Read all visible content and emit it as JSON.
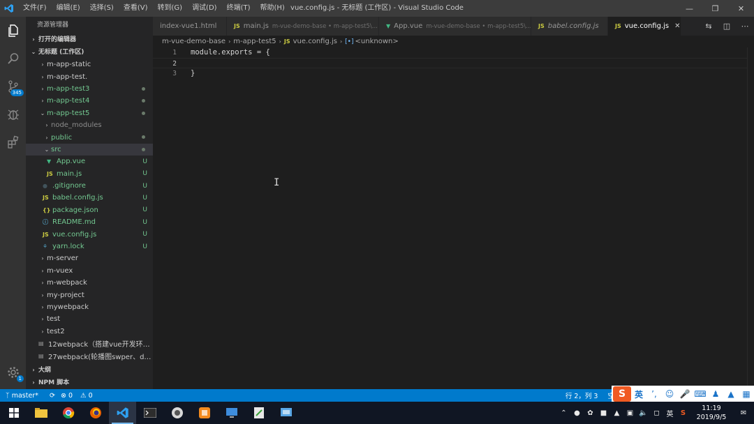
{
  "titlebar": {
    "menu": [
      "文件(F)",
      "编辑(E)",
      "选择(S)",
      "查看(V)",
      "转到(G)",
      "调试(D)",
      "终端(T)",
      "帮助(H)"
    ],
    "title": "vue.config.js - 无标题 (工作区) - Visual Studio Code"
  },
  "activity": {
    "scm_badge": "345",
    "settings_badge": "1"
  },
  "sidebar": {
    "title": "资源管理器",
    "open_editors": "打开的编辑器",
    "workspace": "无标题 (工作区)",
    "outline": "大纲",
    "npm": "NPM 脚本",
    "tree": [
      {
        "label": "m-app-static",
        "chev": "›",
        "indent": 1,
        "color": "white"
      },
      {
        "label": "m-app-test.",
        "chev": "›",
        "indent": 1,
        "color": "white"
      },
      {
        "label": "m-app-test3",
        "chev": "›",
        "indent": 1,
        "color": "green",
        "dot": true
      },
      {
        "label": "m-app-test4",
        "chev": "›",
        "indent": 1,
        "color": "green",
        "dot": true
      },
      {
        "label": "m-app-test5",
        "chev": "⌄",
        "indent": 1,
        "color": "green",
        "dot": true
      },
      {
        "label": "node_modules",
        "chev": "›",
        "indent": 2,
        "color": "dim"
      },
      {
        "label": "public",
        "chev": "›",
        "indent": 2,
        "color": "green",
        "dot": true
      },
      {
        "label": "src",
        "chev": "⌄",
        "indent": 2,
        "color": "green",
        "dot": true,
        "selected": true
      },
      {
        "label": "App.vue",
        "icon": "vue",
        "indent": 3,
        "color": "green",
        "status": "U"
      },
      {
        "label": "main.js",
        "icon": "JS",
        "indent": 3,
        "color": "green",
        "status": "U"
      },
      {
        "label": ".gitignore",
        "icon": "git",
        "indent": 2,
        "color": "green",
        "status": "U"
      },
      {
        "label": "babel.config.js",
        "icon": "JS",
        "indent": 2,
        "color": "green",
        "status": "U"
      },
      {
        "label": "package.json",
        "icon": "{}",
        "indent": 2,
        "color": "green",
        "status": "U"
      },
      {
        "label": "README.md",
        "icon": "info",
        "indent": 2,
        "color": "green",
        "status": "U"
      },
      {
        "label": "vue.config.js",
        "icon": "JS",
        "indent": 2,
        "color": "green",
        "status": "U"
      },
      {
        "label": "yarn.lock",
        "icon": "yarn",
        "indent": 2,
        "color": "green",
        "status": "U"
      },
      {
        "label": "m-server",
        "chev": "›",
        "indent": 1,
        "color": "white"
      },
      {
        "label": "m-vuex",
        "chev": "›",
        "indent": 1,
        "color": "white"
      },
      {
        "label": "m-webpack",
        "chev": "›",
        "indent": 1,
        "color": "white"
      },
      {
        "label": "my-project",
        "chev": "›",
        "indent": 1,
        "color": "white"
      },
      {
        "label": "mywebpack",
        "chev": "›",
        "indent": 1,
        "color": "white"
      },
      {
        "label": "test",
        "chev": "›",
        "indent": 1,
        "color": "white"
      },
      {
        "label": "test2",
        "chev": "›",
        "indent": 1,
        "color": "white"
      },
      {
        "label": "12webpack（搭建vue开发环境...",
        "icon": "doc",
        "indent": 1,
        "color": "white"
      },
      {
        "label": "27webpack(轮播图swper、dev...",
        "icon": "doc",
        "indent": 1,
        "color": "white"
      }
    ]
  },
  "tabs": [
    {
      "label": "index-vue1.html",
      "icon": "",
      "desc": ""
    },
    {
      "label": "main.js",
      "icon": "JS",
      "desc": "m-vue-demo-base • m-app-test5\\..."
    },
    {
      "label": "App.vue",
      "icon": "vue",
      "desc": "m-vue-demo-base • m-app-test5\\..."
    },
    {
      "label": "babel.config.js",
      "icon": "JS",
      "desc": ""
    },
    {
      "label": "vue.config.js",
      "icon": "JS",
      "desc": "",
      "active": true
    }
  ],
  "breadcrumb": [
    "m-vue-demo-base",
    "m-app-test5",
    "vue.config.js",
    "<unknown>"
  ],
  "editor": {
    "lines": [
      {
        "n": "1",
        "code": "module.exports = {"
      },
      {
        "n": "2",
        "code": ""
      },
      {
        "n": "3",
        "code": "}"
      }
    ]
  },
  "statusbar": {
    "branch": "master*",
    "errors": "0",
    "warnings": "0",
    "position": "行 2，列 3",
    "spaces": "空"
  },
  "ime": {
    "lang": "英"
  },
  "taskbar": {
    "time": "11:19",
    "date": "2019/9/5",
    "tray_lang": "英"
  }
}
